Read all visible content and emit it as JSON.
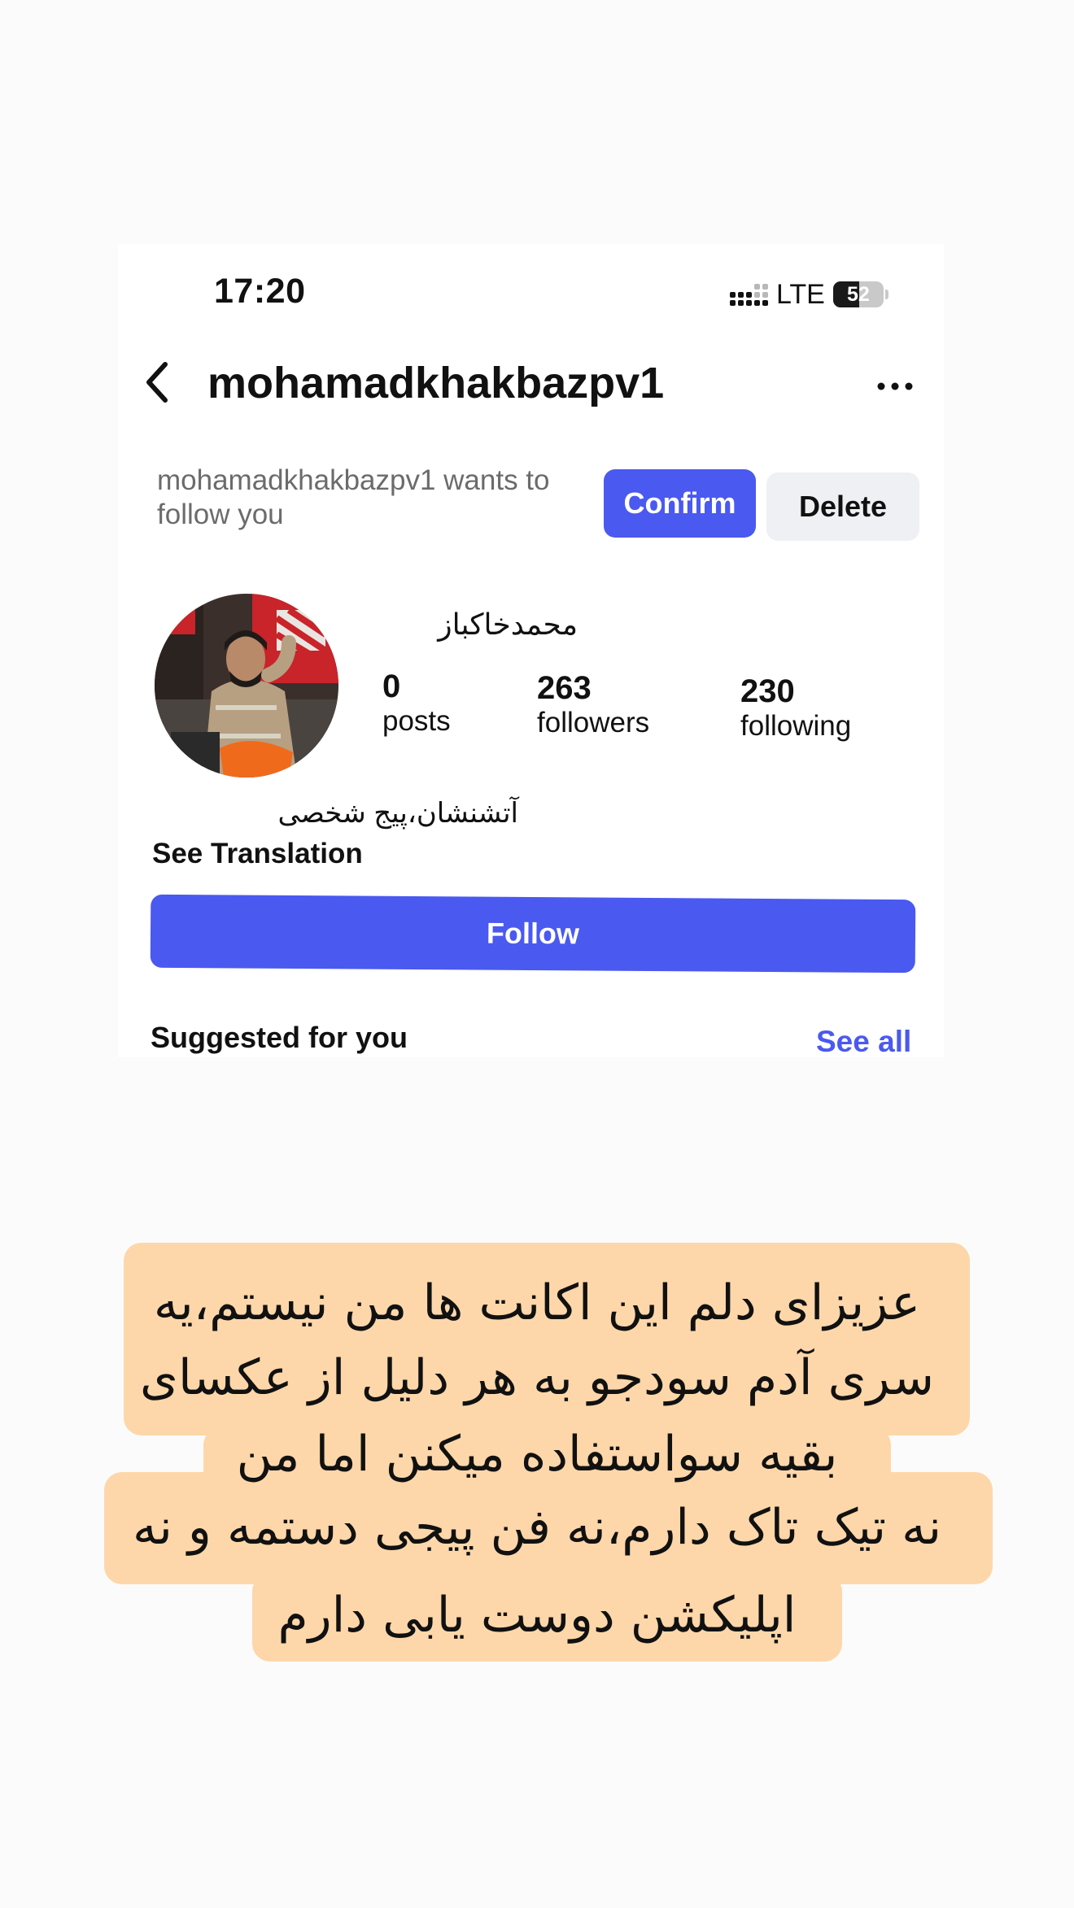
{
  "status_bar": {
    "time": "17:20",
    "network": "LTE",
    "battery_level": "52",
    "battery_fraction": 0.52
  },
  "header": {
    "username": "mohamadkhakbazpv1",
    "back_icon": "chevron-left-icon",
    "more_icon": "more-horizontal-icon"
  },
  "follow_request": {
    "message": "mohamadkhakbazpv1 wants to follow you",
    "confirm_label": "Confirm",
    "delete_label": "Delete"
  },
  "profile": {
    "display_name": "محمدخاکباز",
    "posts_count": "0",
    "posts_label": "posts",
    "followers_count": "263",
    "followers_label": "followers",
    "following_count": "230",
    "following_label": "following",
    "bio": "آتشنشان،پیج شخصی",
    "see_translation": "See Translation",
    "follow_label": "Follow"
  },
  "suggested": {
    "title": "Suggested for you",
    "see_all": "See all"
  },
  "caption": {
    "lines": [
      "عزیزای دلم این اکانت ها من نیستم،یه",
      "سری آدم سودجو به هر دلیل از عکسای",
      "بقیه سواستفاده میکنن اما من",
      "نه تیک تاک دارم،نه فن پیجی دستمه و نه",
      "اپلیکشن دوست یابی دارم"
    ]
  },
  "colors": {
    "accent": "#4a59f0",
    "caption_background": "#fdd7aa",
    "secondary_button": "#eef0f3"
  }
}
